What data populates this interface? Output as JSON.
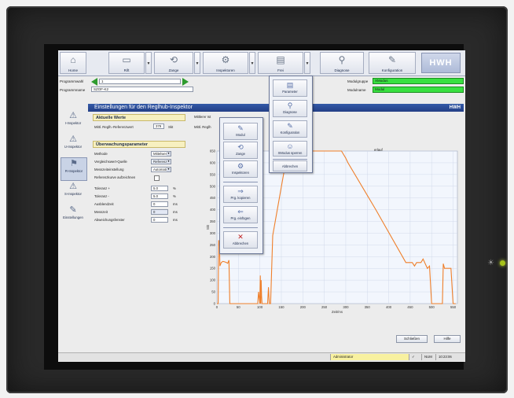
{
  "toolbar": {
    "buttons": [
      {
        "label": "Home",
        "icon": "house-icon"
      },
      {
        "label": "Rift",
        "icon": "rift-icon"
      },
      {
        "label": "Zange",
        "icon": "tongs-icon"
      },
      {
        "label": "Inspektoren",
        "icon": "inspector-icon"
      },
      {
        "label": "Frei",
        "icon": "free-icon"
      },
      {
        "label": "Diagnose",
        "icon": "search-icon"
      },
      {
        "label": "Konfiguration",
        "icon": "wrench-icon"
      }
    ],
    "logo": "HWH"
  },
  "program": {
    "prog_select_label": "Programmwahl",
    "prog_select_value": "1",
    "prog_name_label": "Programmname",
    "prog_name_value": "SZOF-K2",
    "module_group_label": "Modulgruppe",
    "module_group_value": "XModus",
    "module_name_label": "Modulname",
    "module_name_value": "Modul"
  },
  "leftnav": [
    {
      "label": "I-Inspektor",
      "icon": "inspector-i-icon"
    },
    {
      "label": "U-Inspektor",
      "icon": "inspector-u-icon"
    },
    {
      "label": "R-Inspektor",
      "icon": "inspector-r-icon"
    },
    {
      "label": "S-Inspektor",
      "icon": "inspector-s-icon"
    },
    {
      "label": "Einstellungen",
      "icon": "settings-wrench-icon"
    }
  ],
  "main": {
    "title": "Einstellungen für den Reglhub-Inspektor",
    "logo": "HWH",
    "current_values": {
      "heading": "Aktuelle Werte",
      "ref_label": "Mittl. Reglh.-Referenzwert",
      "ref_value": "379",
      "ref_unit": "Skt",
      "mid_label": "Mittlerer Ist",
      "mid_label2": "Mittl. Reglh"
    },
    "monitoring": {
      "heading": "Überwachungsparameter",
      "rows": [
        {
          "label": "Methode",
          "value": "Mittelwer",
          "type": "select",
          "unit": ""
        },
        {
          "label": "Vergleichswert-Quelle",
          "value": "Referenz",
          "type": "select",
          "unit": ""
        },
        {
          "label": "Messzeiteinstellung",
          "value": "Automati",
          "type": "select",
          "unit": ""
        },
        {
          "label": "Referenzkurve aufzeichnen",
          "value": "",
          "type": "checkbox",
          "unit": ""
        },
        {
          "label": "Toleranz +",
          "value": "5.0",
          "type": "input",
          "unit": "%"
        },
        {
          "label": "Toleranz -",
          "value": "5.0",
          "type": "input",
          "unit": "%"
        },
        {
          "label": "Ausblendzeit",
          "value": "0",
          "type": "input",
          "unit": "ms"
        },
        {
          "label": "Messzeit",
          "value": "0",
          "type": "input",
          "unit": "ms"
        },
        {
          "label": "Abweichungsfenster",
          "value": "0",
          "type": "input",
          "unit": "ms"
        }
      ]
    },
    "chart_caption": "erlauf",
    "buttons": {
      "close": "Schließen",
      "help": "Hilfe"
    }
  },
  "popup_left": {
    "items": [
      "Modul",
      "Zange",
      "Inspektoren",
      "Prg. kopieren",
      "Prg. einfügen",
      "Abbrechen"
    ]
  },
  "popup_right": {
    "items": [
      "Parameter",
      "Diagnose",
      "Konfiguration",
      "XModus sperren",
      "Abbrechen"
    ]
  },
  "status": {
    "user": "Administrator",
    "check": "✓",
    "num": "NUM",
    "time": "10:23:06"
  },
  "colors": {
    "accent": "#2b4a99",
    "curve": "#ef7f2a",
    "green": "#38e040"
  },
  "chart_data": {
    "type": "line",
    "title": "",
    "xlabel": "Zeit/ms",
    "ylabel": "Skt",
    "xlim": [
      0,
      560
    ],
    "ylim": [
      0,
      650
    ],
    "xticks": [
      0,
      50,
      100,
      150,
      200,
      250,
      300,
      350,
      400,
      450,
      500,
      550
    ],
    "yticks": [
      0,
      50,
      100,
      150,
      200,
      250,
      300,
      350,
      400,
      450,
      500,
      550,
      600,
      650
    ],
    "grid": true,
    "series": [
      {
        "x": [
          0,
          3,
          4,
          6,
          7,
          10,
          14,
          18,
          22,
          25,
          28,
          30,
          95,
          97,
          100,
          101,
          102,
          103,
          104,
          105,
          115,
          118,
          120,
          122,
          125,
          130,
          160,
          200,
          250,
          282,
          290,
          300,
          305,
          370,
          440,
          455,
          460,
          465,
          475,
          480,
          490,
          495,
          500,
          505,
          520,
          525,
          527,
          530,
          535,
          545,
          550,
          556
        ],
        "y": [
          0,
          0,
          270,
          250,
          160,
          175,
          180,
          178,
          175,
          172,
          185,
          0,
          0,
          50,
          0,
          120,
          0,
          100,
          35,
          0,
          0,
          0,
          70,
          0,
          0,
          290,
          600,
          655,
          655,
          655,
          650,
          620,
          600,
          400,
          175,
          175,
          160,
          175,
          175,
          190,
          150,
          160,
          0,
          0,
          0,
          0,
          170,
          150,
          150,
          150,
          0,
          0
        ]
      }
    ]
  }
}
